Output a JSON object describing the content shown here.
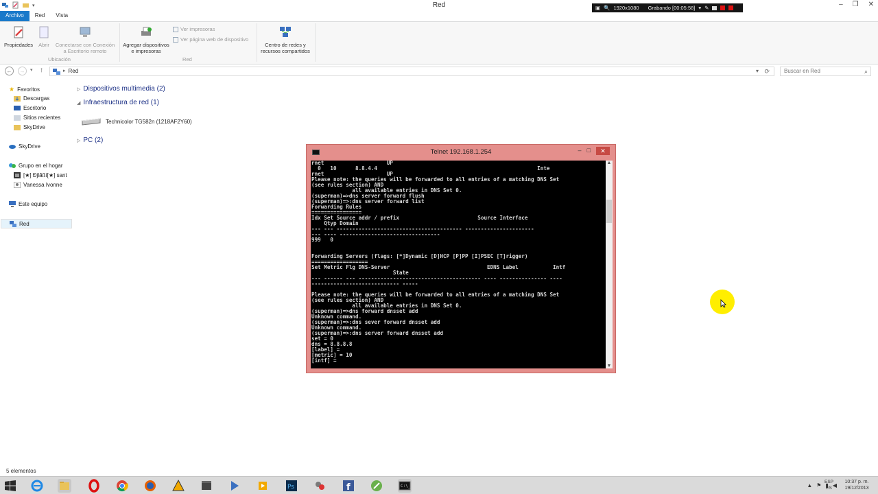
{
  "window": {
    "title": "Red"
  },
  "recording": {
    "resolution": "1920x1080",
    "status": "Grabando [00:05:58]"
  },
  "ribbon": {
    "tabs": [
      {
        "label": "Archivo",
        "active": true
      },
      {
        "label": "Red",
        "active": false
      },
      {
        "label": "Vista",
        "active": false
      }
    ],
    "buttons": {
      "properties": "Propiedades",
      "open": "Abrir",
      "connect_remote_l1": "Conectarse con Conexión",
      "connect_remote_l2": "a Escritorio remoto",
      "add_devices_l1": "Agregar dispositivos",
      "add_devices_l2": "e impresoras",
      "view_printers": "Ver impresoras",
      "view_device_page": "Ver página web de dispositivo",
      "network_center_l1": "Centro de redes y",
      "network_center_l2": "recursos compartidos"
    },
    "groups": {
      "location": "Ubicación",
      "network": "Red"
    }
  },
  "address": {
    "path": "Red",
    "search_placeholder": "Buscar en Red"
  },
  "navpane": {
    "favorites": "Favoritos",
    "downloads": "Descargas",
    "desktop": "Escritorio",
    "recent": "Sitios recientes",
    "skydrive_fav": "SkyDrive",
    "skydrive": "SkyDrive",
    "homegroup": "Grupo en el hogar",
    "home_user1": "[★] Ðjlãßí[★] sant",
    "home_user2": "Vanessa Ivonne",
    "this_pc": "Este equipo",
    "network": "Red"
  },
  "content": {
    "groups": [
      {
        "label": "Dispositivos multimedia (2)",
        "expanded": false
      },
      {
        "label": "Infraestructura de red (1)",
        "expanded": true
      },
      {
        "label": "PC (2)",
        "expanded": false
      }
    ],
    "device": "Technicolor TG582n (1218AF2Y60)"
  },
  "status": {
    "count": "5 elementos"
  },
  "telnet": {
    "title": "Telnet 192.168.1.254",
    "console": "rnet                    UP\n  0   10      8.8.4.4                                                   Inte\nrnet                    UP\nPlease note: the queries will be forwarded to all entries of a matching DNS Set\n(see rules section) AND\n             all available entries in DNS Set 0.\n(superman)=>dns server forward flush\n(superman)=>:dns server forward list\nForwarding Rules\n================\nIdx Set Source addr / prefix                         Source Interface\n    Qtyp Domain\n--- --- ---------------------------------------- ----------------------\n--- ---- --------------------------------\n999   0\n\n\nForwarding Servers (flags: [*]Dynamic [D]HCP [P]PP [I]PSEC [T]rigger)\n==================\nSet Metric Flg DNS-Server                               EDNS Label           Intf\n                          State\n--- ------ --- --------------------------------------- ---- --------------- ----\n---------------------------- -----\n\nPlease note: the queries will be forwarded to all entries of a matching DNS Set\n(see rules section) AND\n             all available entries in DNS Set 0.\n(superman)=>dns forward dnsset add\nUnknown command.\n(superman)=>:dns sever forward dnsset add\nUnknown command.\n(superman)=>:dns server forward dnsset add\nset = 0\ndns = 8.8.8.8\n[label] =\n[metric] = 10\n[intf] ="
  },
  "tray": {
    "lang_l1": "ESP",
    "lang_l2": "ES",
    "time": "10:37 p. m.",
    "date": "19/12/2013"
  },
  "colors": {
    "accent": "#1979ca",
    "telnet_frame": "#e48f8c",
    "cursor_highlight": "#ffee00"
  }
}
